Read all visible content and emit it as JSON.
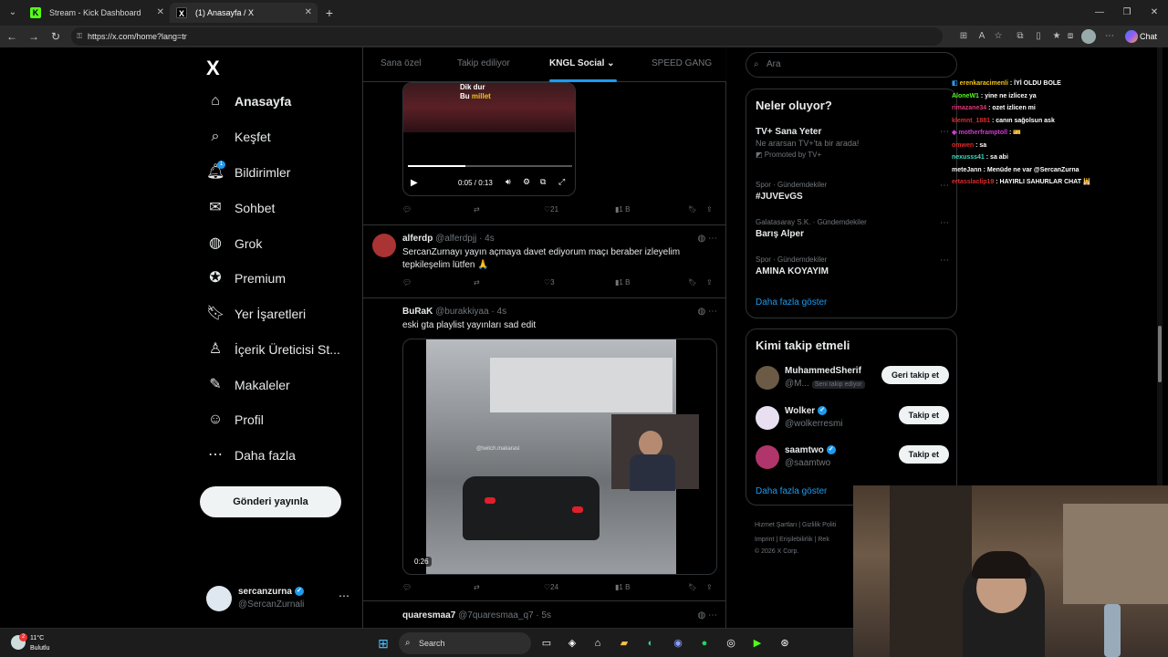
{
  "browser": {
    "tabs": [
      {
        "title": "Stream - Kick Dashboard",
        "favicon": "K"
      },
      {
        "title": "(1) Anasayfa / X",
        "favicon": "X"
      }
    ],
    "url": "https://x.com/home?lang=tr",
    "chat_button": "Chat"
  },
  "nav": {
    "logo": "X",
    "items": [
      {
        "label": "Anasayfa",
        "icon": "home-icon",
        "glyph": "⌂"
      },
      {
        "label": "Keşfet",
        "icon": "search-icon",
        "glyph": "⌕"
      },
      {
        "label": "Bildirimler",
        "icon": "bell-icon",
        "glyph": "🔔︎",
        "badge": "1"
      },
      {
        "label": "Sohbet",
        "icon": "mail-icon",
        "glyph": "✉"
      },
      {
        "label": "Grok",
        "icon": "grok-icon",
        "glyph": "◍"
      },
      {
        "label": "Premium",
        "icon": "premium-icon",
        "glyph": "✪"
      },
      {
        "label": "Yer İşaretleri",
        "icon": "bookmark-icon",
        "glyph": "🔖︎"
      },
      {
        "label": "İçerik Üreticisi St...",
        "icon": "creator-icon",
        "glyph": "♙"
      },
      {
        "label": "Makaleler",
        "icon": "article-icon",
        "glyph": "✎"
      },
      {
        "label": "Profil",
        "icon": "profile-icon",
        "glyph": "☺"
      },
      {
        "label": "Daha fazla",
        "icon": "more-icon",
        "glyph": "⋯"
      }
    ],
    "post_button": "Gönderi yayınla",
    "account": {
      "name": "sercanzurna",
      "handle": "@SercanZurnali"
    }
  },
  "center": {
    "tabs": [
      "Sana özel",
      "Takip ediliyor",
      "KNGL Social",
      "SPEED GANG"
    ],
    "active_tab": "KNGL Social",
    "video1": {
      "overlay_line1": "Dik dur",
      "overlay_line2_a": "Bu",
      "overlay_line2_b": "millet",
      "time": "0:05 / 0:13",
      "progress": 0.35
    },
    "actions1": {
      "likes": "21",
      "views": "1 B"
    },
    "post2": {
      "name": "alferdp",
      "meta": "@alferdpjj · 4s",
      "text": "SercanZurnayı yayın açmaya davet ediyorum maçı beraber izleyelim tepkileşelim lütfen 🙏"
    },
    "actions2": {
      "likes": "3",
      "views": "1 B"
    },
    "post3": {
      "name": "BuRaK",
      "meta": "@burakkiyaa · 4s",
      "text": "eski  gta playlist yayınları sad edit"
    },
    "video2": {
      "duration": "0:26",
      "watermark": "@twitch.makarasi"
    },
    "actions3": {
      "likes": "24",
      "views": "1 B"
    },
    "post4": {
      "name": "quaresmaa7",
      "meta": "@7quaresmaa_q7 · 5s"
    }
  },
  "right": {
    "search_placeholder": "Ara",
    "trends_title": "Neler oluyor?",
    "promo": {
      "name": "TV+ Sana Yeter",
      "sub": "Ne ararsan TV+'ta bir arada!",
      "tag": "Promoted by TV+"
    },
    "trends": [
      {
        "meta": "Spor · Gündemdekiler",
        "name": "#JUVEvGS"
      },
      {
        "meta": "Galatasaray S.K. · Gündemdekiler",
        "name": "Barış Alper"
      },
      {
        "meta": "Spor · Gündemdekiler",
        "name": "AMINA KOYAYIM"
      }
    ],
    "trends_more": "Daha fazla göster",
    "who_title": "Kimi takip etmeli",
    "who": [
      {
        "name": "MuhammedSherif",
        "handle": "@M...",
        "tag": "Seni takip ediyor",
        "button": "Geri takip et"
      },
      {
        "name": "Wolker",
        "handle": "@wolkerresmi",
        "button": "Takip et"
      },
      {
        "name": "saamtwo",
        "handle": "@saamtwo",
        "button": "Takip et"
      }
    ],
    "who_more": "Daha fazla göster",
    "footer": {
      "line1": "Hizmet Şartları  |  Gizlilik Politi",
      "line2": "Imprint  |  Erişilebilirlik  |  Rek",
      "line3": "© 2026 X Corp."
    }
  },
  "chat": [
    {
      "user": "erenkaracimenli",
      "color": "#f0c419",
      "msg": "İYİ OLDU BOLE"
    },
    {
      "user": "AloneW1",
      "color": "#53fc18",
      "msg": "yine ne izlicez ya"
    },
    {
      "user": "rimazane34",
      "color": "#e03a7a",
      "msg": "ozet izlicen mi"
    },
    {
      "user": "klemnt_1881",
      "color": "#e02a2a",
      "msg": "canın sağolsun ask"
    },
    {
      "user": "motherframptoll",
      "color": "#d23ad2",
      "msg": "🎫"
    },
    {
      "user": "omwen",
      "color": "#e02a2a",
      "msg": "sa"
    },
    {
      "user": "nexusss41",
      "color": "#3ae0c4",
      "msg": "sa abi"
    },
    {
      "user": "meteJann",
      "color": "#f5f5f5",
      "msg": "Menüde ne var @SercanZurna"
    },
    {
      "user": "ertasslaclip19",
      "color": "#e02a2a",
      "msg": "HAYIRLI SAHURLAR CHAT 🕌"
    }
  ],
  "taskbar": {
    "weather_temp": "11°C",
    "weather_desc": "Bulutlu",
    "weather_badge": "2",
    "search": "Search"
  }
}
